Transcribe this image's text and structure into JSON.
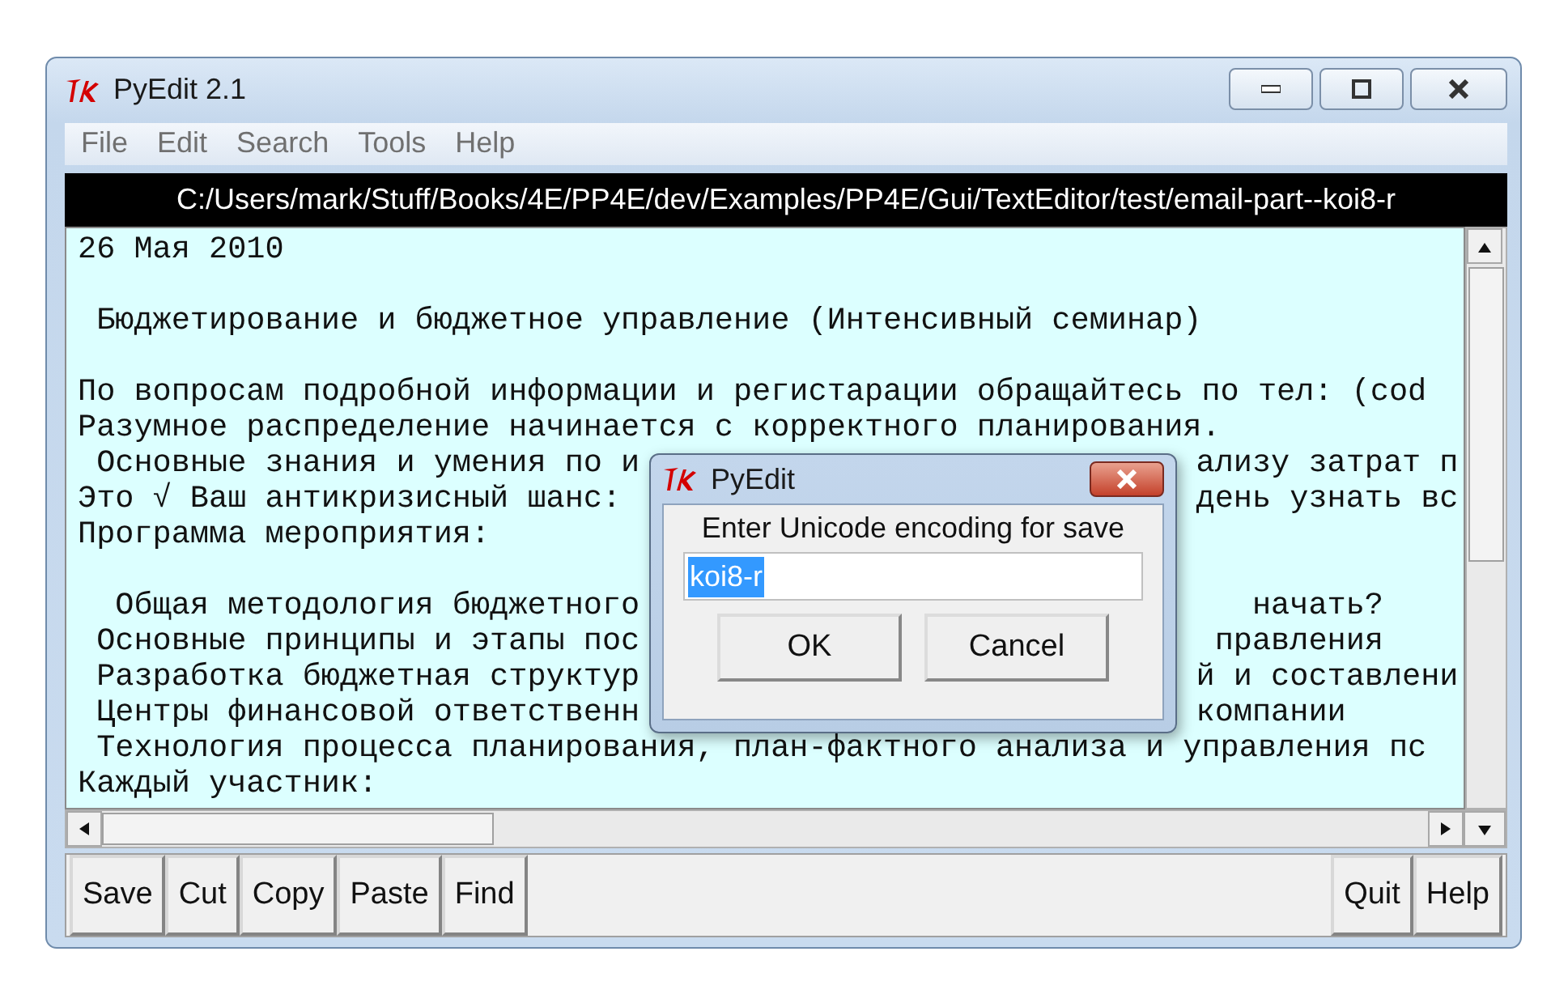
{
  "window": {
    "title": "PyEdit 2.1"
  },
  "menu": [
    "File",
    "Edit",
    "Search",
    "Tools",
    "Help"
  ],
  "path": "C:/Users/mark/Stuff/Books/4E/PP4E/dev/Examples/PP4E/Gui/TextEditor/test/email-part--koi8-r",
  "editor": {
    "lines": [
      {
        "kind": "text",
        "left": "26 Мая 2010"
      },
      {
        "kind": "blank"
      },
      {
        "kind": "text",
        "left": " Бюджетирование и бюджетное управление (Интенсивный семинар)"
      },
      {
        "kind": "blank"
      },
      {
        "kind": "text",
        "left": "По вопросам подробной информации и регистарации обращайтесь по тел: (cod"
      },
      {
        "kind": "text",
        "left": "Разумное распределение начинается с корректного планирования."
      },
      {
        "kind": "text",
        "left": " Основные знания и умения по и",
        "right": "ализу затрат п"
      },
      {
        "kind": "text",
        "left": "Это √ Ваш антикризисный шанс:",
        "right": "день узнать вс"
      },
      {
        "kind": "text",
        "left": "Программа мероприятия:"
      },
      {
        "kind": "blank"
      },
      {
        "kind": "text",
        "left": "  Общая методология бюджетного",
        "right": "   начать?"
      },
      {
        "kind": "text",
        "left": " Основные принципы и этапы пос",
        "right": " правления"
      },
      {
        "kind": "text",
        "left": " Разработка бюджетная структур",
        "right": "й и составлени"
      },
      {
        "kind": "text",
        "left": " Центры финансовой ответственн",
        "right": "компании"
      },
      {
        "kind": "text",
        "left": " Технология процесса планирования, план-фактного анализа и управления пс"
      },
      {
        "kind": "text",
        "left": "Каждый участник:"
      }
    ]
  },
  "dialog": {
    "title": "PyEdit",
    "prompt": "Enter Unicode encoding for save",
    "input": {
      "value": "koi8-r",
      "selected": true
    },
    "buttons": [
      "OK",
      "Cancel"
    ]
  },
  "toolbar": {
    "left": [
      "Save",
      "Cut",
      "Copy",
      "Paste",
      "Find"
    ],
    "right": [
      "Quit",
      "Help"
    ]
  }
}
